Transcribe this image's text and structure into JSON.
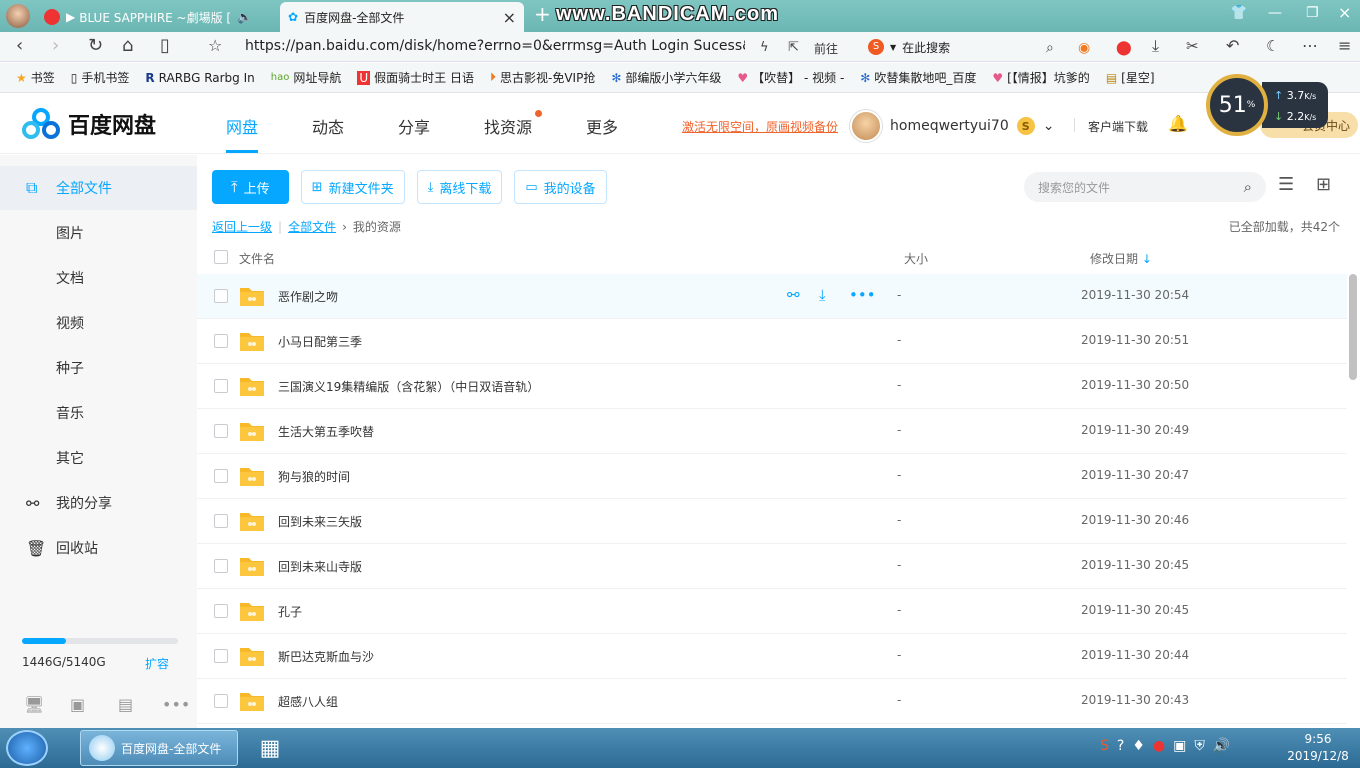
{
  "browser": {
    "tabs": [
      {
        "label": "BLUE SAPPHIRE ~劇場版 [",
        "active": false
      },
      {
        "label": "百度网盘-全部文件",
        "active": true
      }
    ],
    "watermark": "www.BANDICAM.com",
    "url": "https://pan.baidu.com/disk/home?errno=0&errmsg=Auth Login Sucess&&",
    "goto_label": "前往",
    "search_label": "在此搜索"
  },
  "bookmarks": [
    {
      "icon": "star-icon",
      "label": "书签"
    },
    {
      "icon": "phone-icon",
      "label": "手机书签"
    },
    {
      "icon": "r-logo-icon",
      "label": "RARBG Rarbg In"
    },
    {
      "icon": "hao-icon",
      "label": "网址导航"
    },
    {
      "icon": "u-logo-icon",
      "label": "假面骑士时王 日语"
    },
    {
      "icon": "play-icon",
      "label": "思古影视-免VIP抢"
    },
    {
      "icon": "paw-icon",
      "label": "部编版小学六年级"
    },
    {
      "icon": "heart-icon",
      "label": "【吹替】 - 视频 -"
    },
    {
      "icon": "paw-icon",
      "label": "吹替集散地吧_百度"
    },
    {
      "icon": "heart-icon",
      "label": "[【情报】坑爹的"
    },
    {
      "icon": "folder-icon",
      "label": "[星空]"
    }
  ],
  "speed_widget": {
    "percent": "51",
    "percent_sign": "%",
    "up": "3.7",
    "down": "2.2",
    "unit": "K/s"
  },
  "header": {
    "logo": "百度网盘",
    "nav": [
      "网盘",
      "动态",
      "分享",
      "找资源",
      "更多"
    ],
    "promo": "激活无限空间，原画视频备份",
    "username": "homeqwertyui70",
    "vip_badge": "S",
    "client_download": "客户端下载",
    "member_center": "会员中心"
  },
  "sidebar": {
    "items": [
      {
        "label": "全部文件",
        "active": true,
        "icon": "file-icon"
      },
      {
        "label": "图片"
      },
      {
        "label": "文档"
      },
      {
        "label": "视频"
      },
      {
        "label": "种子"
      },
      {
        "label": "音乐"
      },
      {
        "label": "其它"
      },
      {
        "label": "我的分享",
        "icon": "share-icon"
      },
      {
        "label": "回收站",
        "icon": "trash-icon"
      }
    ],
    "quota": "1446G/5140G",
    "quota_fraction": 0.28,
    "expand": "扩容"
  },
  "toolbar": {
    "upload": "上传",
    "new_folder": "新建文件夹",
    "offline_download": "离线下载",
    "my_devices": "我的设备",
    "search_placeholder": "搜索您的文件"
  },
  "breadcrumb": {
    "back": "返回上一级",
    "root": "全部文件",
    "current": "我的资源"
  },
  "loaded_status": "已全部加载，共42个",
  "table": {
    "columns": {
      "name": "文件名",
      "size": "大小",
      "date": "修改日期"
    },
    "rows": [
      {
        "name": "恶作剧之吻",
        "size": "-",
        "date": "2019-11-30 20:54"
      },
      {
        "name": "小马日配第三季",
        "size": "-",
        "date": "2019-11-30 20:51"
      },
      {
        "name": "三国演义19集精编版（含花絮）（中日双语音轨）",
        "size": "-",
        "date": "2019-11-30 20:50"
      },
      {
        "name": "生活大第五季吹替",
        "size": "-",
        "date": "2019-11-30 20:49"
      },
      {
        "name": "狗与狼的时间",
        "size": "-",
        "date": "2019-11-30 20:47"
      },
      {
        "name": "回到未来三矢版",
        "size": "-",
        "date": "2019-11-30 20:46"
      },
      {
        "name": "回到未来山寺版",
        "size": "-",
        "date": "2019-11-30 20:45"
      },
      {
        "name": "孔子",
        "size": "-",
        "date": "2019-11-30 20:45"
      },
      {
        "name": "斯巴达克斯血与沙",
        "size": "-",
        "date": "2019-11-30 20:44"
      },
      {
        "name": "超感八人组",
        "size": "-",
        "date": "2019-11-30 20:43"
      }
    ]
  },
  "taskbar": {
    "app_label": "百度网盘-全部文件",
    "time": "9:56",
    "date": "2019/12/8"
  },
  "colors": {
    "accent": "#06a7ff",
    "promo": "#f0632b",
    "folder": "#fcc73f"
  }
}
